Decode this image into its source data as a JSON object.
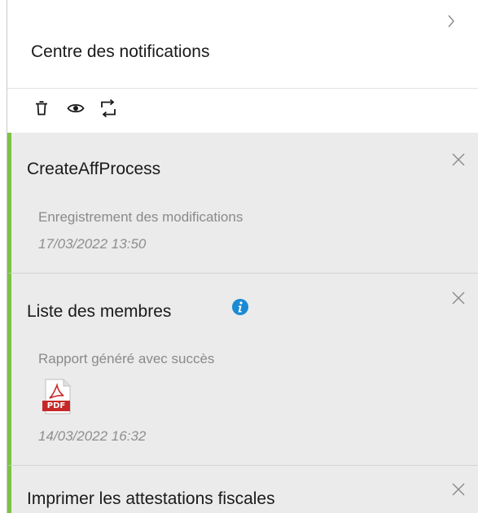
{
  "header": {
    "title": "Centre des notifications"
  },
  "icons": {
    "collapse": "chevron-right-icon",
    "delete": "trash-icon",
    "mark_read": "eye-icon",
    "refresh": "refresh-icon",
    "close": "close-icon",
    "info": "info-icon",
    "pdf": "pdf-file-icon"
  },
  "colors": {
    "accent_bar": "#7dc242",
    "card_bg": "#ebebeb",
    "info_blue": "#1a8ad4",
    "pdf_red": "#c62828"
  },
  "notifications": [
    {
      "title": "CreateAffProcess",
      "message": "Enregistrement des modifications",
      "date": "17/03/2022 13:50"
    },
    {
      "title": "Liste des membres",
      "message": "Rapport généré avec succès",
      "attachment_label": "PDF",
      "date": "14/03/2022 16:32"
    },
    {
      "title": "Imprimer les attestations fiscales"
    }
  ]
}
